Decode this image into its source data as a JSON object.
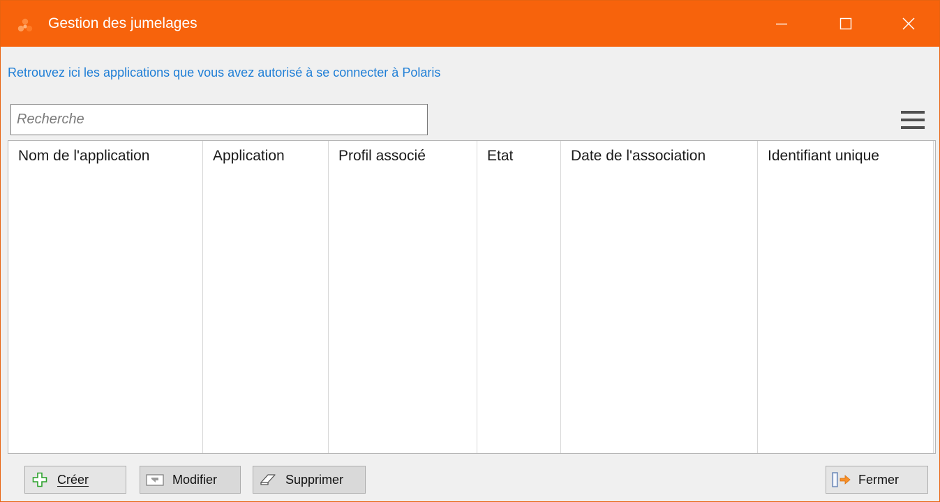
{
  "window": {
    "title": "Gestion des jumelages",
    "accent_color": "#f7630c",
    "icons": {
      "app": "app-logo-icon",
      "minimize": "minimize-icon",
      "maximize": "maximize-icon",
      "close": "close-icon"
    }
  },
  "subtitle": "Retrouvez ici les applications que vous avez autorisé à se connecter à Polaris",
  "search": {
    "placeholder": "Recherche",
    "value": ""
  },
  "menu": {
    "icon": "hamburger-menu-icon"
  },
  "table": {
    "columns": [
      "Nom de l'application",
      "Application",
      "Profil associé",
      "Etat",
      "Date de l'association",
      "Identifiant unique"
    ],
    "rows": []
  },
  "buttons": {
    "create": {
      "label": "Créer",
      "icon": "plus-icon"
    },
    "modify": {
      "label": "Modifier",
      "icon": "edit-icon"
    },
    "delete": {
      "label": "Supprimer",
      "icon": "eraser-icon"
    },
    "close": {
      "label": "Fermer",
      "icon": "exit-door-icon"
    }
  }
}
